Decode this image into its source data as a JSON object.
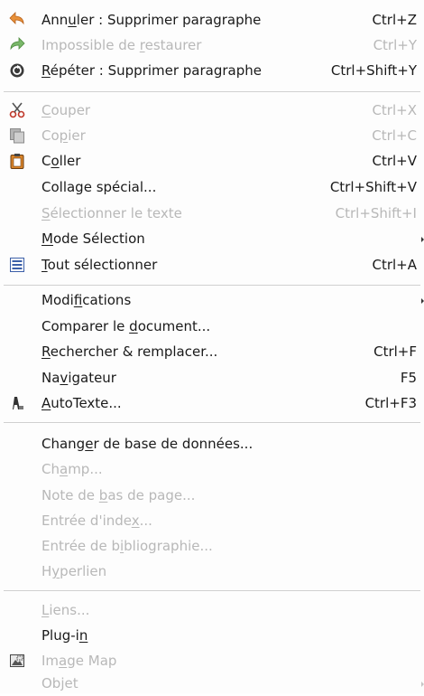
{
  "menu": {
    "items": [
      {
        "label": "Annuler : Supprimer paragraphe",
        "shortcut": "Ctrl+Z",
        "mnemonic": "u",
        "icon": "undo-icon",
        "enabled": true
      },
      {
        "label": "Impossible de restaurer",
        "shortcut": "Ctrl+Y",
        "mnemonic": "r",
        "icon": "redo-icon",
        "enabled": false
      },
      {
        "label": "Répéter : Supprimer paragraphe",
        "shortcut": "Ctrl+Shift+Y",
        "mnemonic": "R",
        "icon": "repeat-icon",
        "enabled": true
      },
      {
        "label": "Couper",
        "shortcut": "Ctrl+X",
        "mnemonic": "C",
        "icon": "scissors-icon",
        "enabled": false
      },
      {
        "label": "Copier",
        "shortcut": "Ctrl+C",
        "mnemonic": "p",
        "icon": "copy-icon",
        "enabled": false
      },
      {
        "label": "Coller",
        "shortcut": "Ctrl+V",
        "mnemonic": "o",
        "icon": "paste-icon",
        "enabled": true
      },
      {
        "label": "Collage spécial...",
        "shortcut": "Ctrl+Shift+V",
        "mnemonic": "",
        "icon": "",
        "enabled": true
      },
      {
        "label": "Sélectionner le texte",
        "shortcut": "Ctrl+Shift+I",
        "mnemonic": "S",
        "icon": "",
        "enabled": false
      },
      {
        "label": "Mode Sélection",
        "shortcut": "",
        "mnemonic": "M",
        "icon": "",
        "enabled": true,
        "submenu": true
      },
      {
        "label": "Tout sélectionner",
        "shortcut": "Ctrl+A",
        "mnemonic": "T",
        "icon": "select-all-icon",
        "enabled": true
      },
      {
        "label": "Modifications",
        "shortcut": "",
        "mnemonic": "f",
        "icon": "",
        "enabled": true,
        "submenu": true
      },
      {
        "label": "Comparer le document...",
        "shortcut": "",
        "mnemonic": "d",
        "icon": "",
        "enabled": true
      },
      {
        "label": "Rechercher & remplacer...",
        "shortcut": "Ctrl+F",
        "mnemonic": "R",
        "icon": "",
        "enabled": true
      },
      {
        "label": "Navigateur",
        "shortcut": "F5",
        "mnemonic": "v",
        "icon": "",
        "enabled": true
      },
      {
        "label": "AutoTexte...",
        "shortcut": "Ctrl+F3",
        "mnemonic": "A",
        "icon": "autotext-icon",
        "enabled": true
      },
      {
        "label": "Changer de base de données...",
        "shortcut": "",
        "mnemonic": "e",
        "icon": "",
        "enabled": true
      },
      {
        "label": "Champ...",
        "shortcut": "",
        "mnemonic": "a",
        "icon": "",
        "enabled": false
      },
      {
        "label": "Note de bas de page...",
        "shortcut": "",
        "mnemonic": "b",
        "icon": "",
        "enabled": false
      },
      {
        "label": "Entrée d'index...",
        "shortcut": "",
        "mnemonic": "x",
        "icon": "",
        "enabled": false
      },
      {
        "label": "Entrée de bibliographie...",
        "shortcut": "",
        "mnemonic": "i",
        "icon": "",
        "enabled": false
      },
      {
        "label": "Hyperlien",
        "shortcut": "",
        "mnemonic": "y",
        "icon": "",
        "enabled": false
      },
      {
        "label": "Liens...",
        "shortcut": "",
        "mnemonic": "L",
        "icon": "",
        "enabled": false
      },
      {
        "label": "Plug-in",
        "shortcut": "",
        "mnemonic": "n",
        "icon": "",
        "enabled": true
      },
      {
        "label": "Image Map",
        "shortcut": "",
        "mnemonic": "a",
        "icon": "image-map-icon",
        "enabled": false
      },
      {
        "label": "Objet",
        "shortcut": "",
        "mnemonic": "",
        "icon": "",
        "enabled": false,
        "submenu": true
      }
    ]
  }
}
